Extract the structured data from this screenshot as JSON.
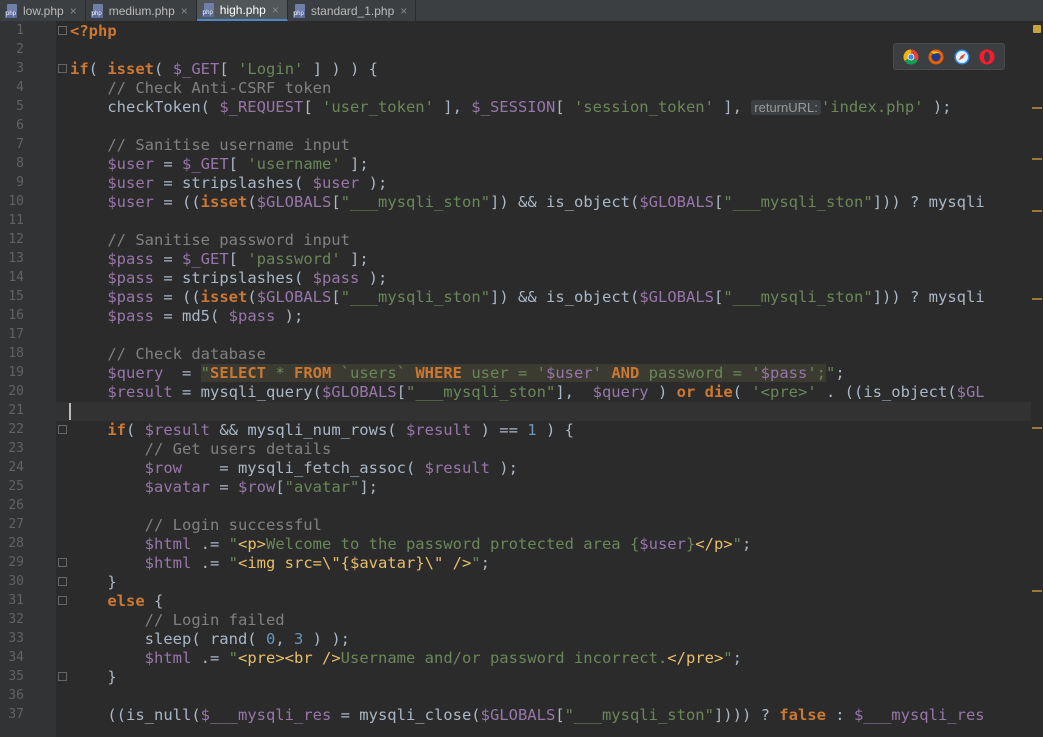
{
  "tabs": [
    {
      "label": "low.php",
      "active": false
    },
    {
      "label": "medium.php",
      "active": false
    },
    {
      "label": "high.php",
      "active": true
    },
    {
      "label": "standard_1.php",
      "active": false
    }
  ],
  "close_glyph": "×",
  "inlay_hint": "returnURL:",
  "browser_icons": [
    "chrome-icon",
    "firefox-icon",
    "safari-icon",
    "opera-icon"
  ],
  "colors": {
    "background": "#2b2b2b",
    "keyword": "#cc7832",
    "string": "#6a8759",
    "variable": "#9876aa",
    "comment": "#808080",
    "number": "#6897bb",
    "html_tag": "#e8bf6a",
    "active_tab_accent": "#4a88c7"
  },
  "code_lines": [
    {
      "num": "1",
      "text": "<?php"
    },
    {
      "num": "2",
      "text": ""
    },
    {
      "num": "3",
      "text": "if( isset( $_GET[ 'Login' ] ) ) {"
    },
    {
      "num": "4",
      "text": "    // Check Anti-CSRF token"
    },
    {
      "num": "5",
      "text": "    checkToken( $_REQUEST[ 'user_token' ], $_SESSION[ 'session_token' ], returnURL:'index.php' );"
    },
    {
      "num": "6",
      "text": ""
    },
    {
      "num": "7",
      "text": "    // Sanitise username input"
    },
    {
      "num": "8",
      "text": "    $user = $_GET[ 'username' ];"
    },
    {
      "num": "9",
      "text": "    $user = stripslashes( $user );"
    },
    {
      "num": "10",
      "text": "    $user = ((isset($GLOBALS[\"___mysqli_ston\"]) && is_object($GLOBALS[\"___mysqli_ston\"])) ? mysqli"
    },
    {
      "num": "11",
      "text": ""
    },
    {
      "num": "12",
      "text": "    // Sanitise password input"
    },
    {
      "num": "13",
      "text": "    $pass = $_GET[ 'password' ];"
    },
    {
      "num": "14",
      "text": "    $pass = stripslashes( $pass );"
    },
    {
      "num": "15",
      "text": "    $pass = ((isset($GLOBALS[\"___mysqli_ston\"]) && is_object($GLOBALS[\"___mysqli_ston\"])) ? mysqli"
    },
    {
      "num": "16",
      "text": "    $pass = md5( $pass );"
    },
    {
      "num": "17",
      "text": ""
    },
    {
      "num": "18",
      "text": "    // Check database"
    },
    {
      "num": "19",
      "text": "    $query  = \"SELECT * FROM `users` WHERE user = '$user' AND password = '$pass';\";"
    },
    {
      "num": "20",
      "text": "    $result = mysqli_query($GLOBALS[\"___mysqli_ston\"],  $query ) or die( '<pre>' . ((is_object($GL"
    },
    {
      "num": "21",
      "text": ""
    },
    {
      "num": "22",
      "text": "    if( $result && mysqli_num_rows( $result ) == 1 ) {"
    },
    {
      "num": "23",
      "text": "        // Get users details"
    },
    {
      "num": "24",
      "text": "        $row    = mysqli_fetch_assoc( $result );"
    },
    {
      "num": "25",
      "text": "        $avatar = $row[\"avatar\"];"
    },
    {
      "num": "26",
      "text": ""
    },
    {
      "num": "27",
      "text": "        // Login successful"
    },
    {
      "num": "28",
      "text": "        $html .= \"<p>Welcome to the password protected area {$user}</p>\";"
    },
    {
      "num": "29",
      "text": "        $html .= \"<img src=\\\"{$avatar}\\\" />\";"
    },
    {
      "num": "30",
      "text": "    }"
    },
    {
      "num": "31",
      "text": "    else {"
    },
    {
      "num": "32",
      "text": "        // Login failed"
    },
    {
      "num": "33",
      "text": "        sleep( rand( 0, 3 ) );"
    },
    {
      "num": "34",
      "text": "        $html .= \"<pre><br />Username and/or password incorrect.</pre>\";"
    },
    {
      "num": "35",
      "text": "    }"
    },
    {
      "num": "36",
      "text": ""
    },
    {
      "num": "37",
      "text": "    ((is_null($___mysqli_res = mysqli_close($GLOBALS[\"___mysqli_ston\"]))) ? false : $___mysqli_res"
    }
  ]
}
